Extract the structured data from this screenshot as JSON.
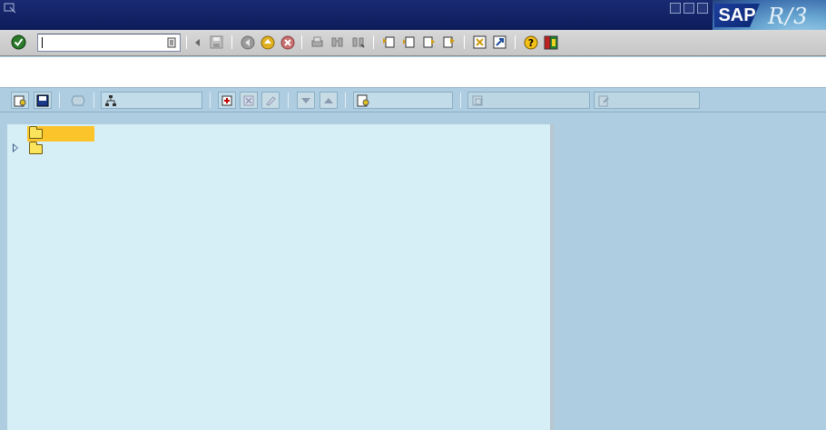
{
  "window": {
    "logo_text": "SAP",
    "logo_release": "R/3"
  },
  "command_field": {
    "value": ""
  },
  "tree": {
    "nodes": [
      {
        "label": "",
        "selected": true,
        "expandable": false
      },
      {
        "label": "",
        "selected": false,
        "expandable": true
      }
    ]
  },
  "application_toolbar": {
    "button_labels": [
      "",
      "",
      "",
      ""
    ]
  },
  "colors": {
    "title_bar": "#0d1c5a",
    "selection": "#fcc42b",
    "tree_background": "#d6eef5"
  }
}
